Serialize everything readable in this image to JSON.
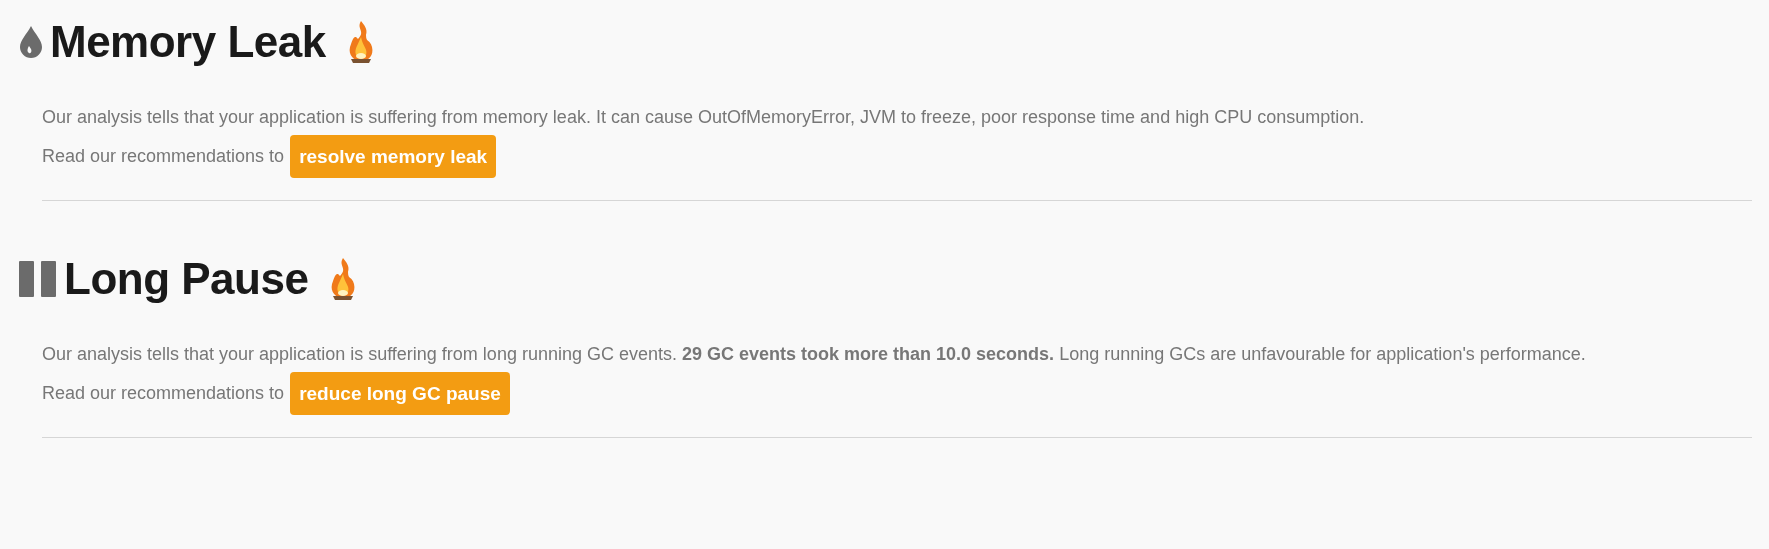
{
  "sections": [
    {
      "kind": "leak",
      "title": "Memory Leak",
      "paragraphs": [
        "Our analysis tells that your application is suffering from memory leak. It can cause OutOfMemoryError, JVM to freeze, poor response time and high CPU consumption."
      ],
      "lead": "Read our recommendations to",
      "button": "resolve memory leak"
    },
    {
      "kind": "pause",
      "title": "Long Pause",
      "paragraphs": [
        "Our analysis tells that your application is suffering from long running GC events. **29 GC events took more than 10.0 seconds.** Long running GCs are unfavourable for application's performance."
      ],
      "lead": "Read our recommendations to",
      "button": "reduce long GC pause"
    }
  ]
}
